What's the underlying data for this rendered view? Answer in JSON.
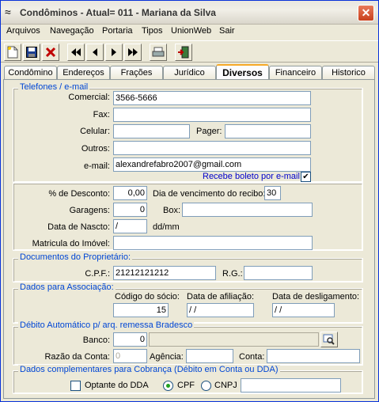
{
  "window": {
    "title": "Condôminos - Atual= 011 - Mariana da Silva",
    "title_icon": "wave-logo-icon",
    "close_label": "✕"
  },
  "menu": [
    {
      "label": "Arquivos"
    },
    {
      "label": "Navegação"
    },
    {
      "label": "Portaria"
    },
    {
      "label": "Tipos"
    },
    {
      "label": "UnionWeb"
    },
    {
      "label": "Sair"
    }
  ],
  "toolbar": {
    "new_icon": "new-document-icon",
    "save_icon": "save-disk-icon",
    "delete_icon": "delete-x-icon",
    "first_icon": "first-record-icon",
    "prev_icon": "previous-record-icon",
    "next_icon": "next-record-icon",
    "last_icon": "last-record-icon",
    "print_icon": "printer-icon",
    "exit_icon": "exit-door-icon"
  },
  "tabs": [
    {
      "label": "Condômino"
    },
    {
      "label": "Endereços"
    },
    {
      "label": "Frações"
    },
    {
      "label": "Jurídico"
    },
    {
      "label": "Diversos"
    },
    {
      "label": "Financeiro"
    },
    {
      "label": "Historico"
    }
  ],
  "contacts": {
    "legend": "Telefones / e-mail",
    "comercial_label": "Comercial:",
    "comercial_value": "3566-5666",
    "fax_label": "Fax:",
    "fax_value": "",
    "celular_label": "Celular:",
    "celular_value": "",
    "pager_label": "Pager:",
    "pager_value": "",
    "outros_label": "Outros:",
    "outros_value": "",
    "email_label": "e-mail:",
    "email_value": "alexandrefabro2007@gmail.com",
    "boleto_label": "Recebe boleto por e-mail",
    "boleto_checked": "✔"
  },
  "misc": {
    "desconto_label": "% de Desconto:",
    "desconto_value": "0,00",
    "vencimento_label": "Dia de vencimento do recibo:",
    "vencimento_value": "30",
    "garagens_label": "Garagens:",
    "garagens_value": "0",
    "box_label": "Box:",
    "box_value": "",
    "nascto_label": "Data de Nascto:",
    "nascto_value": "/",
    "nascto_format": "dd/mm",
    "imovel_label": "Matricula do Imóvel:",
    "imovel_value": ""
  },
  "documents": {
    "legend": "Documentos do Proprietário:",
    "cpf_label": "C.P.F.:",
    "cpf_value": "21212121212",
    "rg_label": "R.G.:",
    "rg_value": ""
  },
  "association": {
    "legend": "Dados para Associação:",
    "codigo_label": "Código do sócio:",
    "codigo_value": "15",
    "afiliacao_label": "Data de afiliação:",
    "afiliacao_value": "/ /",
    "desligamento_label": "Data de desligamento:",
    "desligamento_value": "/ /"
  },
  "debit": {
    "legend": "Débito Automático p/ arq. remessa Bradesco",
    "banco_label": "Banco:",
    "banco_value": "0",
    "banco_name": "",
    "razao_label": "Razão da Conta:",
    "razao_value": "0",
    "agencia_label": "Agência:",
    "agencia_value": "",
    "conta_label": "Conta:",
    "conta_value": ""
  },
  "billing": {
    "legend": "Dados complementares para Cobrança (Débito em Conta ou DDA)",
    "dda_label": "Optante do DDA",
    "cpf_label": "CPF",
    "cnpj_label": "CNPJ",
    "doc_value": ""
  }
}
